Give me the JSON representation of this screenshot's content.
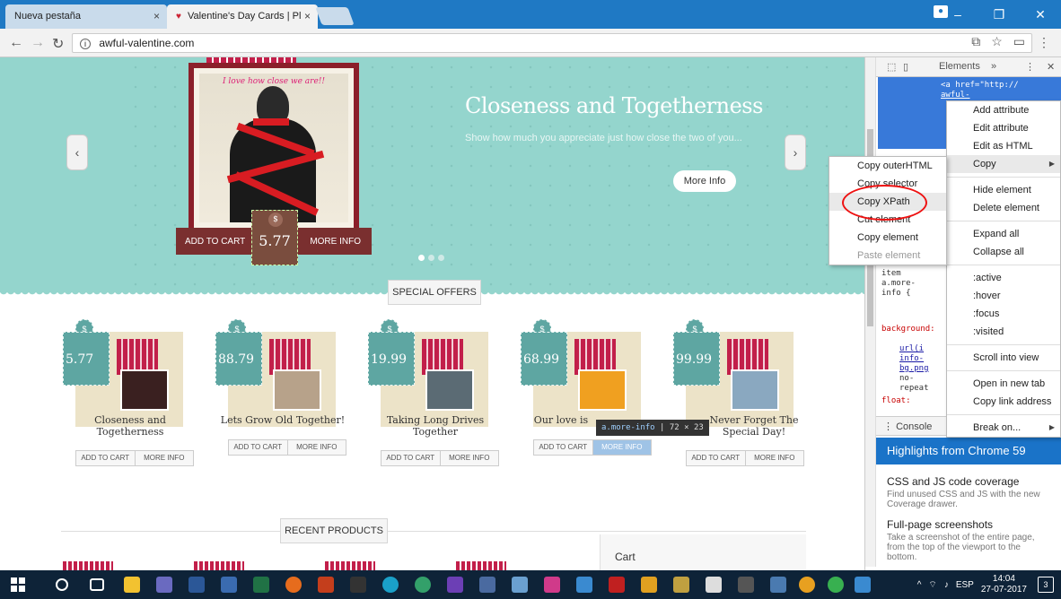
{
  "browser": {
    "tabs": [
      {
        "label": "Nueva pestaña",
        "active": false
      },
      {
        "label": "Valentine's Day Cards | Pl",
        "active": true
      }
    ],
    "tab_close": "×",
    "url": "awful-valentine.com",
    "window_buttons": [
      "–",
      "❐",
      "✕"
    ]
  },
  "hero": {
    "card_caption": "I love how close we are!!",
    "title": "Closeness and Togetherness",
    "text": "Show how much you appreciate just how close the two of you...",
    "button": "More Info",
    "add_to_cart": "ADD TO CART",
    "price": "5.77",
    "more_info": "MORE INFO",
    "prev_icon": "‹",
    "next_icon": "›"
  },
  "sections": {
    "special_offers": "SPECIAL OFFERS",
    "recent_products": "RECENT PRODUCTS",
    "cart": "Cart"
  },
  "products": [
    {
      "price": "5.77",
      "name": "Closeness and Togetherness",
      "add": "ADD TO CART",
      "more": "MORE INFO"
    },
    {
      "price": "88.79",
      "name": "Lets Grow Old Together!",
      "add": "ADD TO CART",
      "more": "MORE INFO"
    },
    {
      "price": "19.99",
      "name": "Taking Long Drives Together",
      "add": "ADD TO CART",
      "more": "MORE INFO"
    },
    {
      "price": "68.99",
      "name": "Our love is",
      "add": "ADD TO CART",
      "more": "MORE INFO"
    },
    {
      "price": "99.99",
      "name": "Never Forget The Special Day!",
      "add": "ADD TO CART",
      "more": "MORE INFO"
    }
  ],
  "tooltip": {
    "selector": "a.more-info",
    "size": "72 × 23"
  },
  "devtools": {
    "tab": "Elements",
    "more": "»",
    "selected_code_1": "<a href=\"http://",
    "selected_code_2": "awful-",
    "code_lines": [
      "item",
      "a.more-",
      "info {",
      "background:",
      "url(i",
      "info-",
      "bg.png",
      "no-",
      "repeat",
      "float:"
    ],
    "console": "Console",
    "drawer_title": "Highlights from Chrome 59",
    "highlights": [
      {
        "title": "CSS and JS code coverage",
        "text": "Find unused CSS and JS with the new Coverage drawer."
      },
      {
        "title": "Full-page screenshots",
        "text": "Take a screenshot of the entire page, from the top of the viewport to the bottom."
      }
    ]
  },
  "context_menu": {
    "items": [
      "Add attribute",
      "Edit attribute",
      "Edit as HTML",
      "Copy",
      "Hide element",
      "Delete element",
      "Expand all",
      "Collapse all",
      ":active",
      ":hover",
      ":focus",
      ":visited",
      "Scroll into view",
      "Open in new tab",
      "Copy link address",
      "Break on..."
    ]
  },
  "copy_submenu": {
    "items": [
      "Copy outerHTML",
      "Copy selector",
      "Copy XPath",
      "Cut element",
      "Copy element",
      "Paste element"
    ]
  },
  "taskbar": {
    "lang": "ESP",
    "time": "14:04",
    "date": "27-07-2017",
    "notifications": "3"
  },
  "colors": {
    "hero_bg": "#94d5cd",
    "price_tag": "#5ea6a2",
    "highlight_circle": "#e11111",
    "drawer_blue": "#1a73c8"
  }
}
